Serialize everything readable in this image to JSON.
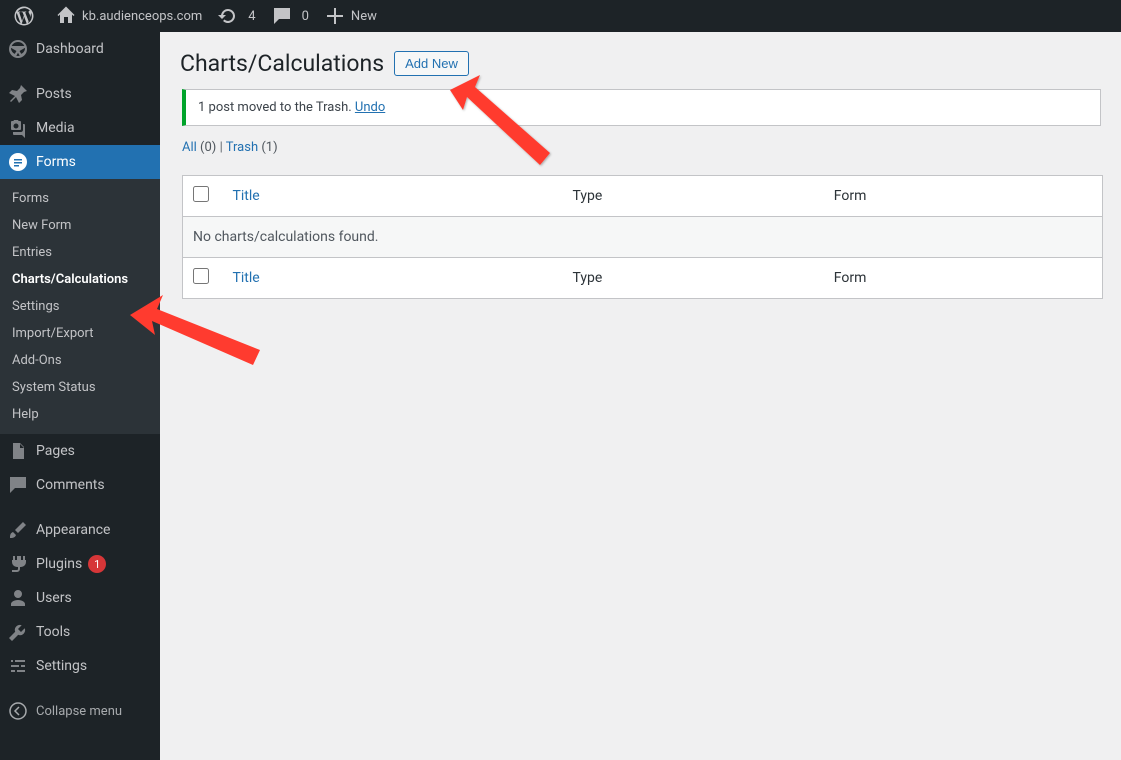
{
  "adminbar": {
    "site_name": "kb.audienceops.com",
    "updates_count": "4",
    "comments_count": "0",
    "new_label": "New"
  },
  "sidebar": {
    "dashboard": "Dashboard",
    "posts": "Posts",
    "media": "Media",
    "forms": "Forms",
    "pages": "Pages",
    "comments": "Comments",
    "appearance": "Appearance",
    "plugins": "Plugins",
    "plugins_count": "1",
    "users": "Users",
    "tools": "Tools",
    "settings": "Settings",
    "collapse": "Collapse menu",
    "submenu": {
      "forms": "Forms",
      "new_form": "New Form",
      "entries": "Entries",
      "charts": "Charts/Calculations",
      "settings": "Settings",
      "import_export": "Import/Export",
      "addons": "Add-Ons",
      "system_status": "System Status",
      "help": "Help"
    }
  },
  "page": {
    "title": "Charts/Calculations",
    "add_new": "Add New",
    "notice_text": "1 post moved to the Trash. ",
    "notice_undo": "Undo",
    "filters": {
      "all_label": "All",
      "all_count": "(0)",
      "sep": " | ",
      "trash_label": "Trash",
      "trash_count": "(1)"
    },
    "table": {
      "col_title": "Title",
      "col_type": "Type",
      "col_form": "Form",
      "empty": "No charts/calculations found."
    }
  }
}
